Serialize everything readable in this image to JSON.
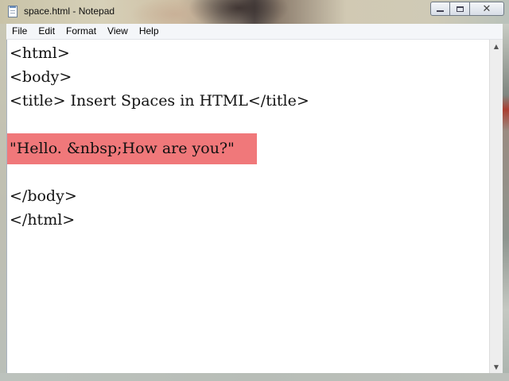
{
  "window": {
    "title": "space.html - Notepad"
  },
  "menu": {
    "items": [
      "File",
      "Edit",
      "Format",
      "View",
      "Help"
    ]
  },
  "editor": {
    "lines": [
      "<html>",
      "<body>",
      "<title> Insert Spaces in HTML</title>",
      "",
      "\"Hello. &nbsp;How are you?\"",
      "",
      "</body>",
      "</html>"
    ],
    "highlight_color": "#f0787a"
  },
  "icons": {
    "app": "notepad-icon",
    "minimize": "minimize-icon",
    "maximize": "maximize-icon",
    "close": "close-icon"
  }
}
